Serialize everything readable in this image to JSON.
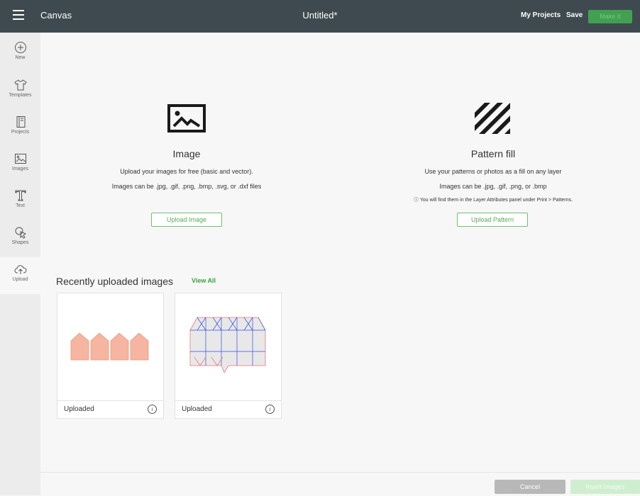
{
  "topbar": {
    "app_title": "Canvas",
    "doc_title": "Untitled*",
    "my_projects": "My Projects",
    "save": "Save",
    "make_it": "Make It"
  },
  "sidebar": {
    "items": [
      {
        "label": "New",
        "icon": "plus-circle-icon"
      },
      {
        "label": "Templates",
        "icon": "shirt-icon"
      },
      {
        "label": "Projects",
        "icon": "project-book-icon"
      },
      {
        "label": "Images",
        "icon": "image-icon"
      },
      {
        "label": "Text",
        "icon": "text-icon"
      },
      {
        "label": "Shapes",
        "icon": "shapes-icon"
      },
      {
        "label": "Upload",
        "icon": "cloud-upload-icon"
      }
    ],
    "active": "Upload"
  },
  "image_section": {
    "title": "Image",
    "line1": "Upload your images for free (basic and vector).",
    "line2": "Images can be .jpg, .gif, .png, .bmp, .svg, or .dxf files",
    "button": "Upload Image"
  },
  "pattern_section": {
    "title": "Pattern fill",
    "line1": "Use your patterns or photos as a fill on any layer",
    "line2": "Images can be .jpg, .gif, .png, or .bmp",
    "note": "ⓘ You will find them in the Layer Attributes panel under Print > Patterns.",
    "button": "Upload Pattern"
  },
  "recent": {
    "title": "Recently uploaded images",
    "view_all": "View All",
    "items": [
      {
        "caption": "Uploaded"
      },
      {
        "caption": "Uploaded"
      }
    ]
  },
  "footer": {
    "cancel": "Cancel",
    "insert": "Insert Images"
  },
  "colors": {
    "topbar": "#3e4a4f",
    "accent_green": "#42a052",
    "thumbnail_fill": "#f5b5a0",
    "template_line": "#3b4fd8"
  },
  "i": "i"
}
